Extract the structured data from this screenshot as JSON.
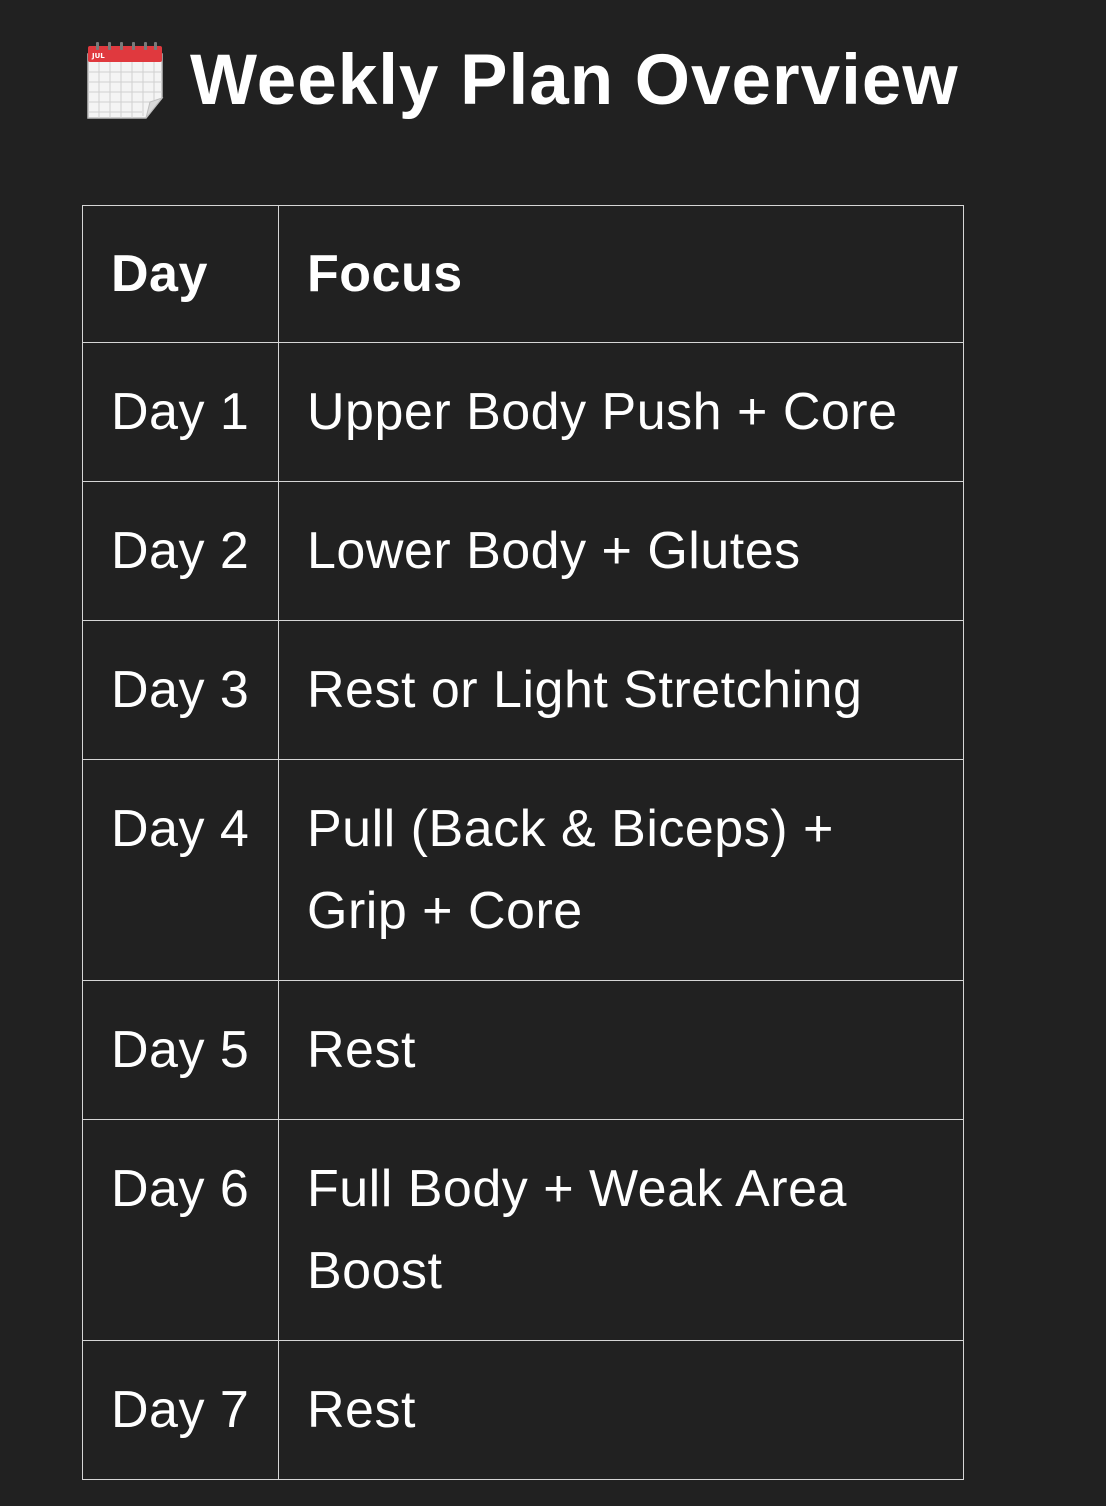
{
  "heading": {
    "icon": "calendar-icon",
    "icon_month": "JUL",
    "title": "Weekly Plan Overview"
  },
  "table": {
    "headers": {
      "day": "Day",
      "focus": "Focus"
    },
    "rows": [
      {
        "day": "Day 1",
        "focus": "Upper Body Push + Core"
      },
      {
        "day": "Day 2",
        "focus": "Lower Body + Glutes"
      },
      {
        "day": "Day 3",
        "focus": "Rest or Light Stretching"
      },
      {
        "day": "Day 4",
        "focus": "Pull (Back & Biceps) + Grip + Core"
      },
      {
        "day": "Day 5",
        "focus": "Rest"
      },
      {
        "day": "Day 6",
        "focus": "Full Body + Weak Area Boost"
      },
      {
        "day": "Day 7",
        "focus": "Rest"
      }
    ]
  },
  "colors": {
    "background": "#212121",
    "text": "#ffffff",
    "border": "#d6d6d6",
    "calendar_red": "#e0393e"
  }
}
